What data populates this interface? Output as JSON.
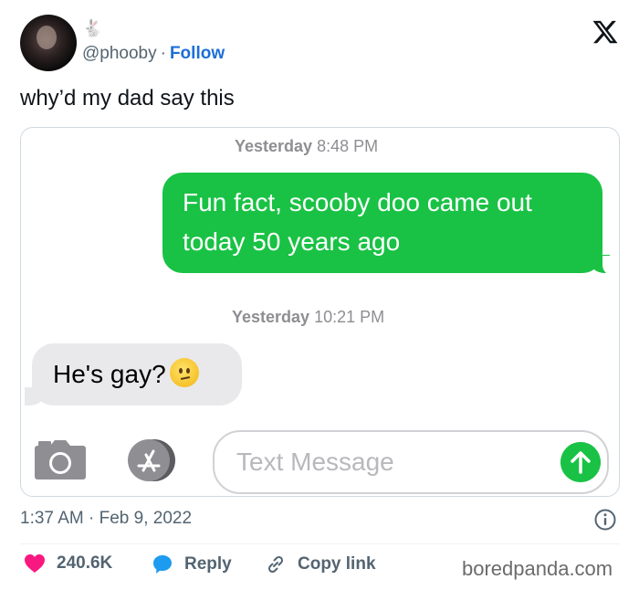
{
  "author": {
    "handle": "@phooby",
    "separator": "·",
    "follow_label": "Follow",
    "badge_emoji": "🐇"
  },
  "tweet": {
    "text": "why’d my dad say this",
    "time": "1:37 AM",
    "date": "Feb 9, 2022",
    "separator": "·"
  },
  "imessage": {
    "messages": [
      {
        "timestamp_day": "Yesterday",
        "timestamp_time": "8:48 PM",
        "direction": "outgoing",
        "text_line1": "Fun fact, scooby doo came out",
        "text_line2": "today 50 years ago"
      },
      {
        "timestamp_day": "Yesterday",
        "timestamp_time": "10:21 PM",
        "direction": "incoming",
        "text": "He's gay?",
        "emoji": "confused-face"
      }
    ],
    "input_placeholder": "Text Message"
  },
  "actions": {
    "likes": "240.6K",
    "reply_label": "Reply",
    "copy_link_label": "Copy link"
  },
  "watermark": "boredpanda.com",
  "colors": {
    "imessage_green": "#19c244",
    "incoming_gray": "#e9e9eb",
    "follow_blue": "#1d6ed8",
    "like_pink": "#f91880",
    "reply_blue": "#1d9bf0"
  },
  "icons": [
    "x-logo-icon",
    "camera-icon",
    "appstore-icon",
    "send-arrow-icon",
    "info-icon",
    "heart-icon",
    "reply-bubble-icon",
    "link-icon"
  ]
}
